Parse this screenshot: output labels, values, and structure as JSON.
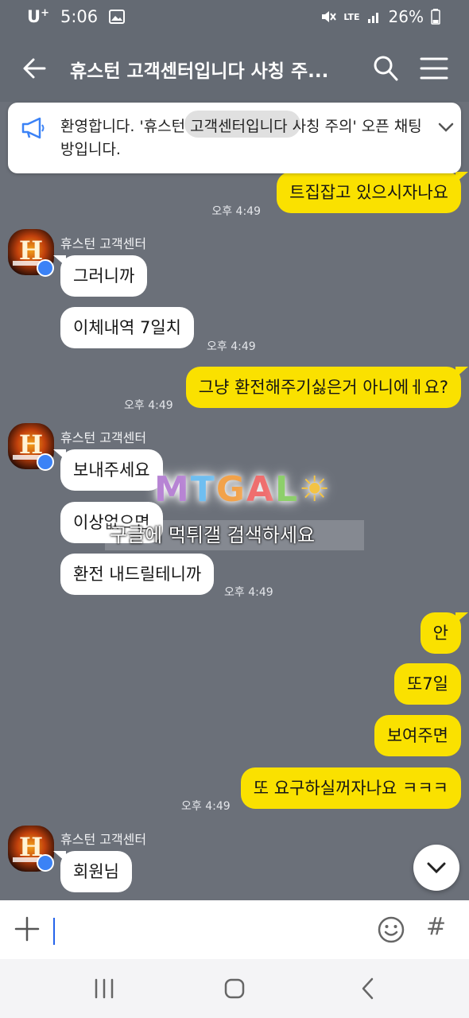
{
  "status_bar": {
    "carrier": "U",
    "carrier_sup": "+",
    "time": "5:06",
    "network": "LTE",
    "battery": "26%"
  },
  "header": {
    "title": "휴스턴 고객센터입니다 사칭 주..."
  },
  "notice": {
    "text": "환영합니다. '휴스턴 고객센터입니다 사칭 주의' 오픈 채팅방입니다."
  },
  "messages": [
    {
      "from": "me",
      "text": "트집잡고 있으시자나요",
      "time": "오후 4:49"
    },
    {
      "from": "other",
      "sender": "휴스턴 고객센터",
      "text": "그러니까"
    },
    {
      "from": "other",
      "text": "이체내역 7일치",
      "time": "오후 4:49"
    },
    {
      "from": "me",
      "text": "그냥 환전해주기싫은거 아니에ㅔ요?",
      "time": "오후 4:49"
    },
    {
      "from": "other",
      "sender": "휴스턴 고객센터",
      "text": "보내주세요"
    },
    {
      "from": "other",
      "text": "이상없으면"
    },
    {
      "from": "other",
      "text": "환전 내드릴테니까",
      "time": "오후 4:49"
    },
    {
      "from": "me",
      "text": "안"
    },
    {
      "from": "me",
      "text": "또7일"
    },
    {
      "from": "me",
      "text": "보여주면"
    },
    {
      "from": "me",
      "text": "또 요구하실꺼자나요 ㅋㅋㅋ",
      "time": "오후 4:49"
    },
    {
      "from": "other",
      "sender": "휴스턴 고객센터",
      "text": "회원님"
    }
  ],
  "watermark": {
    "logo": [
      "M",
      "T",
      "G",
      "A",
      "L",
      "☀"
    ],
    "caption": "구글에 먹튀갤 검색하세요"
  },
  "input": {
    "placeholder": ""
  },
  "icons": {
    "back": "arrow-left-icon",
    "search": "search-icon",
    "menu": "hamburger-menu-icon",
    "notice": "megaphone-icon",
    "expand": "chevron-down-icon",
    "attach": "plus-icon",
    "emoji": "emoji-icon",
    "hashtag": "hash-icon"
  },
  "colors": {
    "chat_bg": "#6b7079",
    "my_bubble": "#fae100",
    "other_bubble": "#ffffff",
    "header_bg": "#646a73"
  }
}
